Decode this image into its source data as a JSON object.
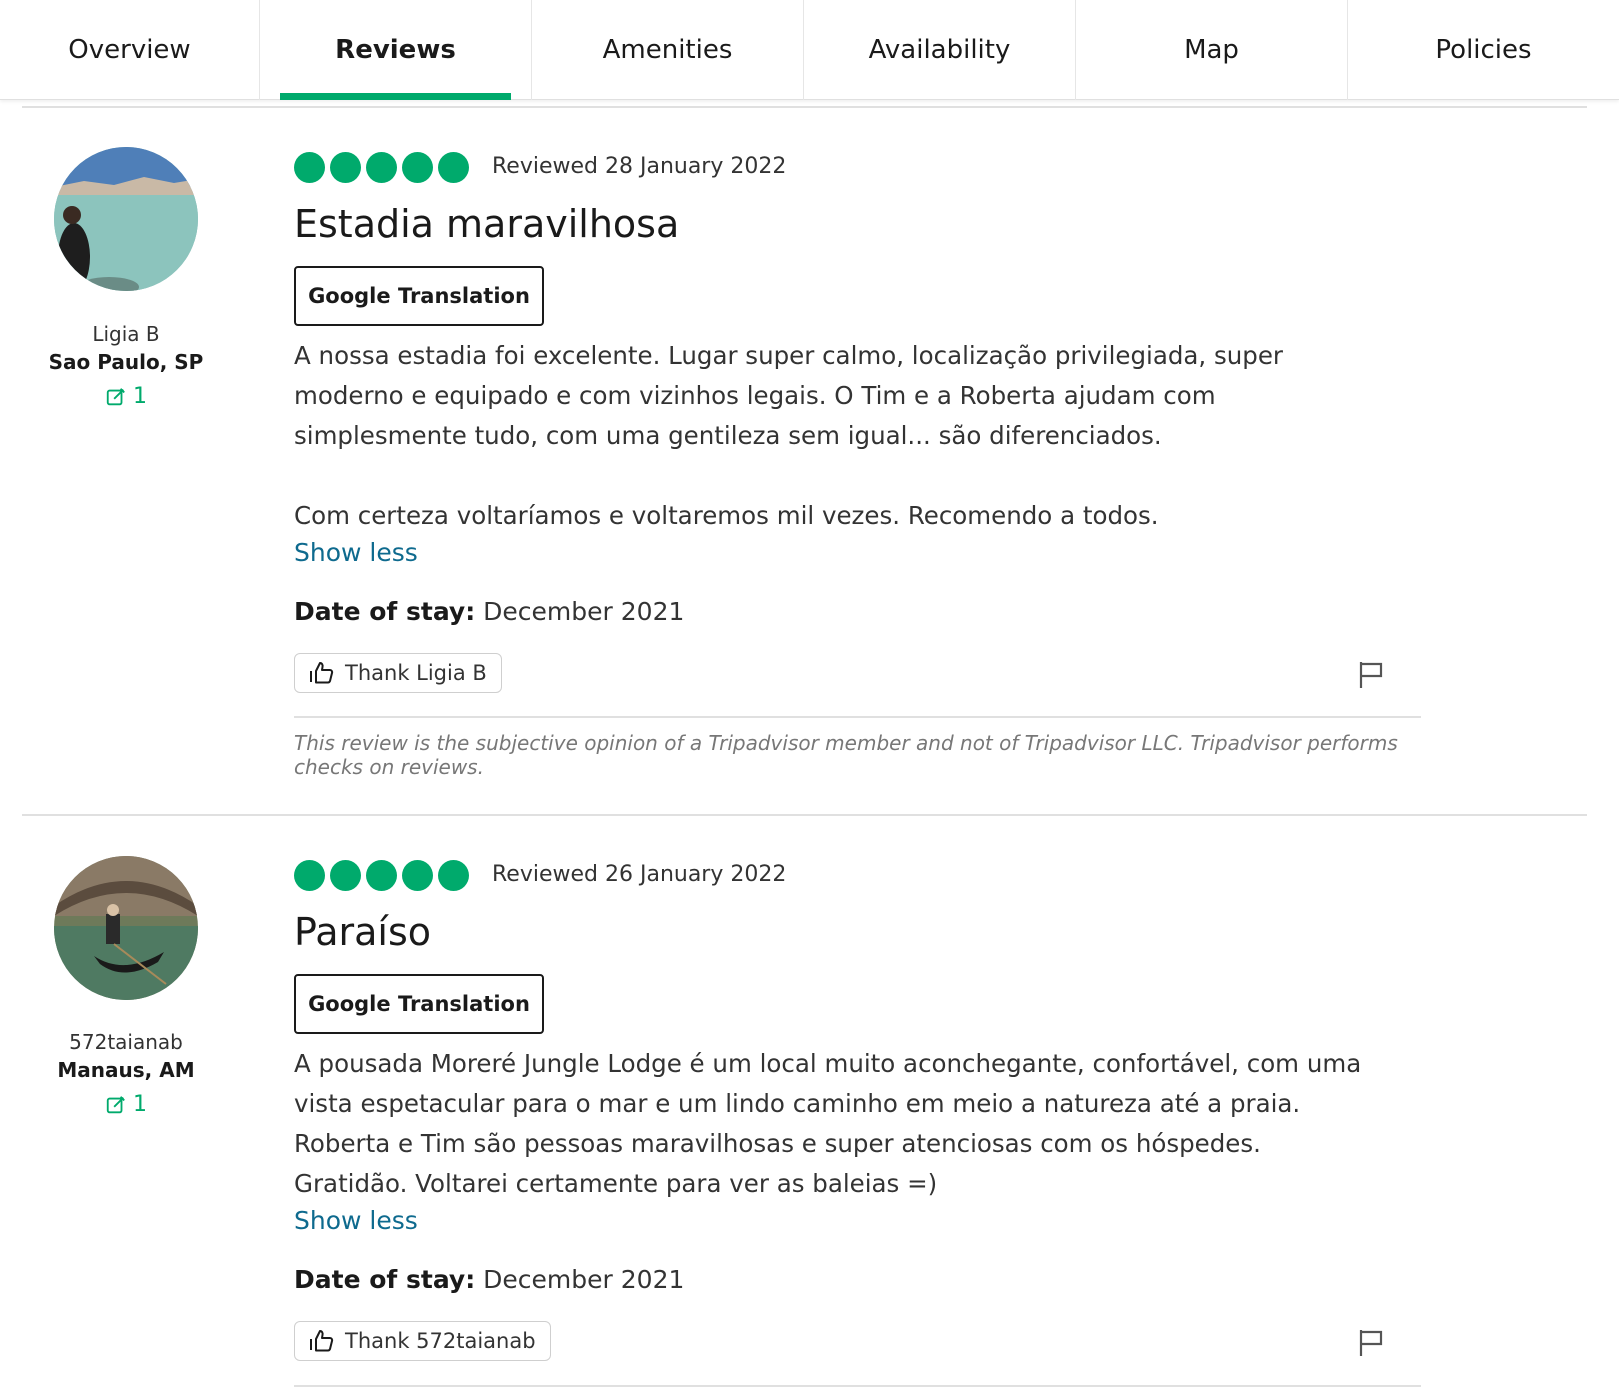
{
  "tabs": [
    {
      "label": "Overview"
    },
    {
      "label": "Reviews"
    },
    {
      "label": "Amenities"
    },
    {
      "label": "Availability"
    },
    {
      "label": "Map"
    },
    {
      "label": "Policies"
    }
  ],
  "active_tab": "Reviews",
  "accent_color": "#00aa6c",
  "link_color": "#0e6a8e",
  "reviews": [
    {
      "user_name": "Ligia B",
      "user_location": "Sao Paulo, SP",
      "contributions": "1",
      "rating": 5,
      "reviewed_date": "Reviewed 28 January 2022",
      "title": "Estadia maravilhosa",
      "translate_label": "Google Translation",
      "body_lines": [
        "A nossa estadia foi excelente. Lugar super calmo, localização privilegiada, super",
        "moderno e equipado e com vizinhos legais. O Tim e a Roberta ajudam com",
        "simplesmente tudo, com uma gentileza sem igual... são diferenciados.",
        "",
        "Com certeza voltaríamos e voltaremos mil vezes. Recomendo a todos."
      ],
      "show_less": "Show less",
      "date_of_stay_label": "Date of stay:",
      "date_of_stay": "December 2021",
      "thank_label": "Thank Ligia B",
      "disclaimer": "This review is the subjective opinion of a Tripadvisor member and not of Tripadvisor LLC. Tripadvisor performs checks on reviews."
    },
    {
      "user_name": "572taianab",
      "user_location": "Manaus, AM",
      "contributions": "1",
      "rating": 5,
      "reviewed_date": "Reviewed 26 January 2022",
      "title": "Paraíso",
      "translate_label": "Google Translation",
      "body_lines": [
        "A pousada Moreré Jungle Lodge é um local muito aconchegante, confortável, com uma",
        "vista espetacular para o mar e um lindo caminho em meio a natureza até a praia.",
        "Roberta e Tim são pessoas maravilhosas e super atenciosas com os hóspedes.",
        "Gratidão. Voltarei certamente para ver as baleias =)"
      ],
      "show_less": "Show less",
      "date_of_stay_label": "Date of stay:",
      "date_of_stay": "December 2021",
      "thank_label": "Thank 572taianab"
    }
  ]
}
